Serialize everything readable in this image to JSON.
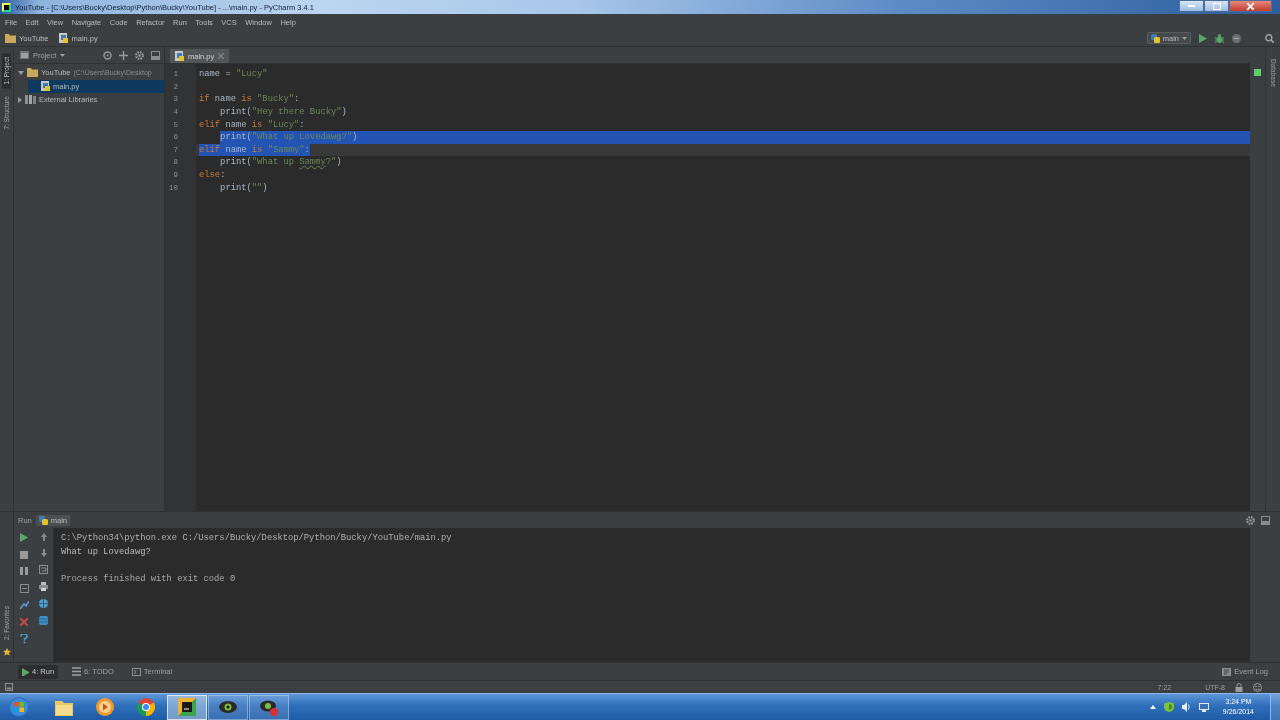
{
  "window": {
    "title": "YouTube - [C:\\Users\\Bucky\\Desktop\\Python\\Bucky\\YouTube] - ...\\main.py - PyCharm 3.4.1"
  },
  "menu": [
    "File",
    "Edit",
    "View",
    "Navigate",
    "Code",
    "Refactor",
    "Run",
    "Tools",
    "VCS",
    "Window",
    "Help"
  ],
  "navigation_bar": {
    "breadcrumbs": [
      "YouTube",
      "main.py"
    ],
    "run_config": "main"
  },
  "left_tool_tabs": [
    {
      "label": "1: Project",
      "selected": true
    },
    {
      "label": "7: Structure",
      "selected": false
    }
  ],
  "project_panel": {
    "title": "Project",
    "tree": [
      {
        "label": "YouTube",
        "path": "(C:\\Users\\Bucky\\Desktop",
        "kind": "folder",
        "expanded": true,
        "selected": false,
        "children": [
          {
            "label": "main.py",
            "kind": "file",
            "selected": true
          }
        ]
      },
      {
        "label": "External Libraries",
        "kind": "library",
        "expanded": false,
        "selected": false
      }
    ]
  },
  "editor": {
    "tabs": [
      {
        "label": "main.py",
        "selected": true
      }
    ],
    "lines": [
      {
        "number": "1",
        "indented": false,
        "current": false,
        "selected": false,
        "eol_selected": false,
        "tokens": [
          {
            "kind": "text",
            "text": "name = "
          },
          {
            "kind": "string",
            "text": "\"Lucy\""
          }
        ]
      },
      {
        "number": "2",
        "current": false,
        "selected": false,
        "eol_selected": false
      },
      {
        "number": "3",
        "indented": false,
        "current": false,
        "selected": false,
        "eol_selected": false,
        "tokens": [
          {
            "kind": "keyword",
            "text": "if"
          },
          {
            "kind": "text",
            "text": " name "
          },
          {
            "kind": "keyword",
            "text": "is"
          },
          {
            "kind": "string",
            "text": " \"Bucky\""
          },
          {
            "kind": "text",
            "text": ":"
          }
        ]
      },
      {
        "number": "4",
        "indented": true,
        "current": false,
        "selected": false,
        "eol_selected": false,
        "tokens": [
          {
            "kind": "text",
            "text": "print("
          },
          {
            "kind": "string",
            "text": "\"Hey there Bucky\""
          },
          {
            "kind": "text",
            "text": ")"
          }
        ]
      },
      {
        "number": "5",
        "indented": false,
        "current": false,
        "selected": false,
        "eol_selected": false,
        "tokens": [
          {
            "kind": "keyword",
            "text": "elif"
          },
          {
            "kind": "text",
            "text": " name "
          },
          {
            "kind": "keyword",
            "text": "is"
          },
          {
            "kind": "string",
            "text": " \"Lucy\""
          },
          {
            "kind": "text",
            "text": ":"
          }
        ]
      },
      {
        "number": "6",
        "indented": true,
        "current": false,
        "selected": true,
        "eol_selected": true,
        "tokens": [
          {
            "kind": "text",
            "text": "print("
          },
          {
            "kind": "string",
            "text": "\"What up Lovedawg?\""
          },
          {
            "kind": "text",
            "text": ")"
          }
        ]
      },
      {
        "number": "7",
        "indented": false,
        "current": true,
        "selected": true,
        "eol_selected": false,
        "tokens": [
          {
            "kind": "keyword",
            "text": "elif"
          },
          {
            "kind": "text",
            "text": " name "
          },
          {
            "kind": "keyword",
            "text": "is"
          },
          {
            "kind": "string",
            "text": " \"Sammy\""
          },
          {
            "kind": "text",
            "text": ":"
          }
        ]
      },
      {
        "number": "8",
        "indented": true,
        "current": false,
        "selected": false,
        "eol_selected": false,
        "tokens": [
          {
            "kind": "text",
            "text": "print("
          },
          {
            "kind": "string",
            "text": "\"What up "
          },
          {
            "kind": "typo",
            "text": "Sammy"
          },
          {
            "kind": "string",
            "text": "?\""
          },
          {
            "kind": "text",
            "text": ")"
          }
        ]
      },
      {
        "number": "9",
        "indented": false,
        "current": false,
        "selected": false,
        "eol_selected": false,
        "tokens": [
          {
            "kind": "keyword",
            "text": "else"
          },
          {
            "kind": "text",
            "text": ":"
          }
        ]
      },
      {
        "number": "10",
        "indented": true,
        "current": false,
        "selected": false,
        "eol_selected": false,
        "tokens": [
          {
            "kind": "text",
            "text": "print("
          },
          {
            "kind": "string",
            "text": "\"\""
          },
          {
            "kind": "text",
            "text": ")"
          }
        ]
      }
    ]
  },
  "right_tool_tabs": [
    {
      "label": "Database",
      "selected": false
    }
  ],
  "run_panel": {
    "title": "Run",
    "tab": "main",
    "output": [
      {
        "kind": "command",
        "text": "C:\\Python34\\python.exe C:/Users/Bucky/Desktop/Python/Bucky/YouTube/main.py"
      },
      {
        "kind": "stdout",
        "text": "What up Lovedawg?"
      },
      {
        "kind": "status",
        "text": "Process finished with exit code 0"
      }
    ],
    "side_tabs": [
      {
        "label": "2: Favorites",
        "selected": false
      }
    ]
  },
  "tool_window_buttons": [
    {
      "label": "4: Run",
      "kind": "run",
      "selected": true
    },
    {
      "label": "6: TODO",
      "kind": "todo",
      "selected": false
    },
    {
      "label": "Terminal",
      "kind": "terminal",
      "selected": false
    }
  ],
  "event_log": "Event Log",
  "status_bar": {
    "position": "7:22",
    "encoding": "UTF-8"
  },
  "taskbar": {
    "apps": [
      {
        "kind": "folder",
        "running": false,
        "selected": false
      },
      {
        "kind": "media",
        "running": false,
        "selected": false
      },
      {
        "kind": "browser",
        "running": false,
        "selected": false
      },
      {
        "kind": "ide",
        "running": true,
        "selected": true
      },
      {
        "kind": "eye",
        "running": true,
        "selected": false
      },
      {
        "kind": "eye_alert",
        "running": true,
        "selected": false
      }
    ],
    "clock": {
      "time": "3:24 PM",
      "date": "9/26/2014"
    }
  }
}
